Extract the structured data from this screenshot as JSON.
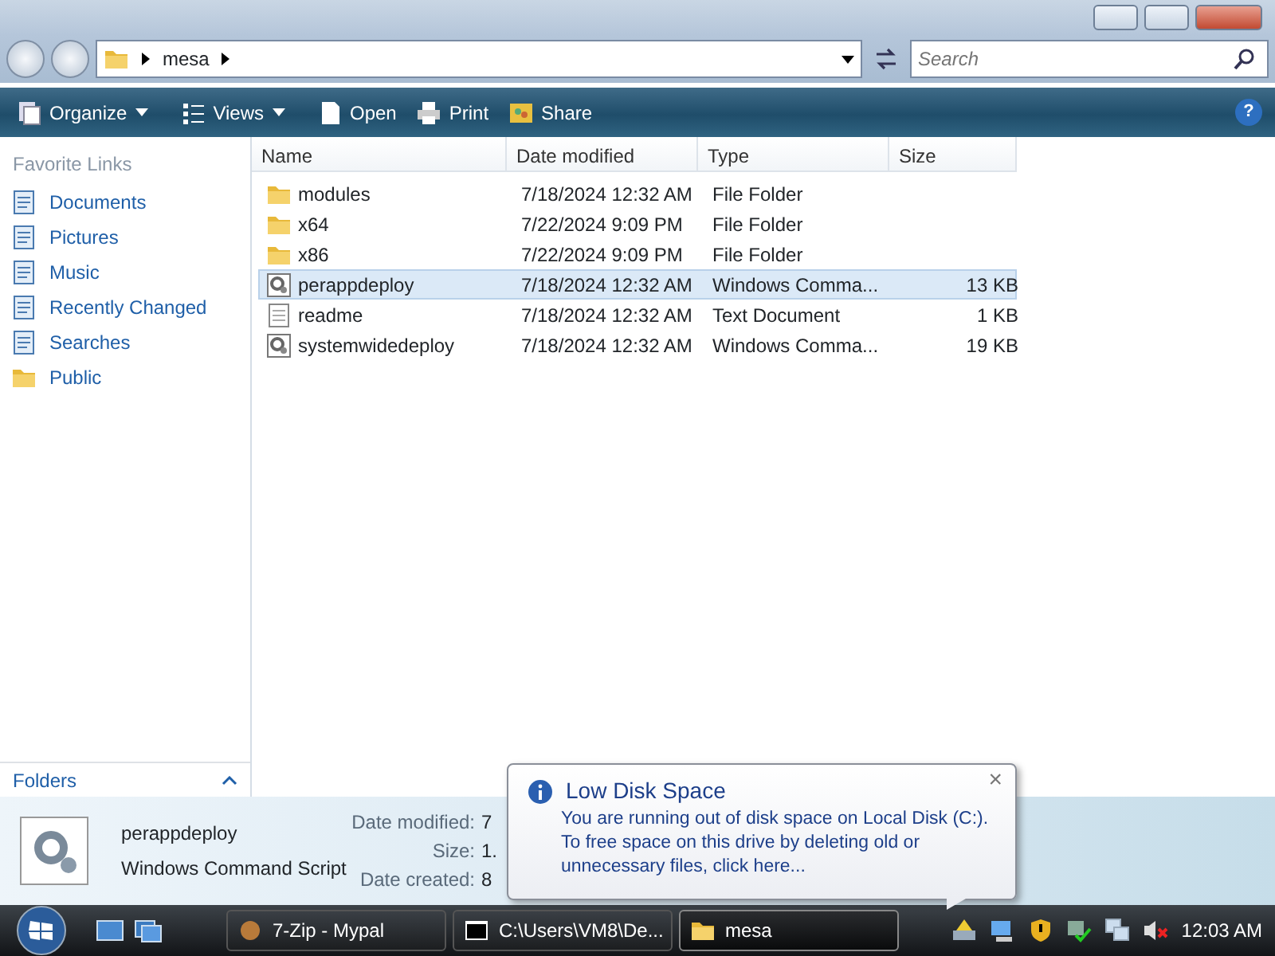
{
  "address": {
    "crumbs": [
      "mesa"
    ]
  },
  "search": {
    "placeholder": "Search"
  },
  "toolbar": [
    {
      "label": "Organize",
      "kind": "organize",
      "menu": true
    },
    {
      "label": "Views",
      "kind": "views",
      "menu": true
    },
    {
      "label": "Open",
      "kind": "open",
      "menu": false
    },
    {
      "label": "Print",
      "kind": "print",
      "menu": false
    },
    {
      "label": "Share",
      "kind": "share",
      "menu": false
    }
  ],
  "help": {
    "label": "?"
  },
  "sidebar": {
    "title": "Favorite Links",
    "items": [
      {
        "label": "Documents",
        "kind": "doc"
      },
      {
        "label": "Pictures",
        "kind": "doc"
      },
      {
        "label": "Music",
        "kind": "doc"
      },
      {
        "label": "Recently Changed",
        "kind": "doc"
      },
      {
        "label": "Searches",
        "kind": "doc"
      },
      {
        "label": "Public",
        "kind": "folder"
      }
    ],
    "folders_label": "Folders"
  },
  "table": {
    "columns": [
      "Name",
      "Date modified",
      "Type",
      "Size"
    ],
    "rows": [
      {
        "kind": "folder",
        "name": "modules",
        "date": "7/18/2024 12:32 AM",
        "type": "File Folder",
        "size": "",
        "selected": false
      },
      {
        "kind": "folder",
        "name": "x64",
        "date": "7/22/2024 9:09 PM",
        "type": "File Folder",
        "size": "",
        "selected": false
      },
      {
        "kind": "folder",
        "name": "x86",
        "date": "7/22/2024 9:09 PM",
        "type": "File Folder",
        "size": "",
        "selected": false
      },
      {
        "kind": "script",
        "name": "perappdeploy",
        "date": "7/18/2024 12:32 AM",
        "type": "Windows Comma...",
        "size": "13 KB",
        "selected": true
      },
      {
        "kind": "text",
        "name": "readme",
        "date": "7/18/2024 12:32 AM",
        "type": "Text Document",
        "size": "1 KB",
        "selected": false
      },
      {
        "kind": "script",
        "name": "systemwidedeploy",
        "date": "7/18/2024 12:32 AM",
        "type": "Windows Comma...",
        "size": "19 KB",
        "selected": false
      }
    ]
  },
  "details": {
    "name": "perappdeploy",
    "type": "Windows Command Script",
    "fields": [
      {
        "label": "Date modified:",
        "value": "7"
      },
      {
        "label": "Size:",
        "value": "1."
      },
      {
        "label": "Date created:",
        "value": "8"
      }
    ]
  },
  "balloon": {
    "title": "Low Disk Space",
    "close": "×",
    "message": "You are running out of disk space on Local Disk (C:). To free space on this drive by deleting old or unnecessary files, click here..."
  },
  "taskbar": {
    "buttons": [
      {
        "label": "7-Zip - Mypal",
        "kind": "app",
        "selected": false
      },
      {
        "label": "C:\\Users\\VM8\\De...",
        "kind": "console",
        "selected": false
      },
      {
        "label": "mesa",
        "kind": "folder",
        "selected": true
      }
    ],
    "clock": "12:03 AM"
  }
}
